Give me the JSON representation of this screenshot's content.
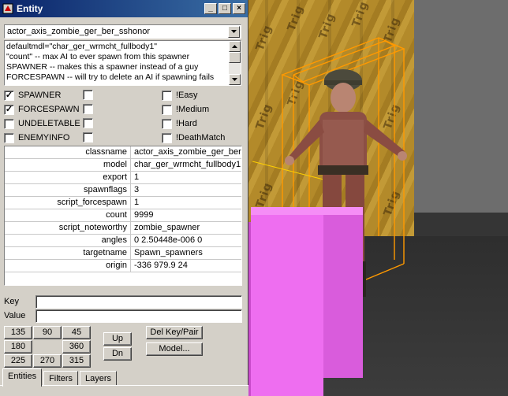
{
  "window": {
    "title": "Entity",
    "buttons": {
      "minimize": "_",
      "maximize": "□",
      "close": "×"
    }
  },
  "classname_combo": {
    "value": "actor_axis_zombie_ger_ber_sshonor"
  },
  "description": [
    "defaultmdl=\"char_ger_wrmcht_fullbody1\"",
    "\"count\" -- max AI to ever spawn from this spawner",
    "SPAWNER -- makes this a spawner instead of a guy",
    "FORCESPAWN -- will try to delete an AI if spawning fails"
  ],
  "flags": {
    "left": [
      {
        "label": "SPAWNER",
        "checked": true
      },
      {
        "label": "FORCESPAWN",
        "checked": true
      },
      {
        "label": "UNDELETABLE",
        "checked": false
      },
      {
        "label": "ENEMYINFO",
        "checked": false
      }
    ],
    "right": [
      {
        "label": "!Easy",
        "checked": false
      },
      {
        "label": "!Medium",
        "checked": false
      },
      {
        "label": "!Hard",
        "checked": false
      },
      {
        "label": "!DeathMatch",
        "checked": false
      }
    ]
  },
  "keyvalues": [
    {
      "key": "classname",
      "value": "actor_axis_zombie_ger_ber"
    },
    {
      "key": "model",
      "value": "char_ger_wrmcht_fullbody1"
    },
    {
      "key": "export",
      "value": "1"
    },
    {
      "key": "spawnflags",
      "value": "3"
    },
    {
      "key": "script_forcespawn",
      "value": "1"
    },
    {
      "key": "count",
      "value": "9999"
    },
    {
      "key": "script_noteworthy",
      "value": "zombie_spawner"
    },
    {
      "key": "angles",
      "value": "0 2.50448e-006 0"
    },
    {
      "key": "targetname",
      "value": "Spawn_spawners"
    },
    {
      "key": "origin",
      "value": "-336 979.9 24"
    }
  ],
  "key_field": {
    "label": "Key",
    "value": ""
  },
  "value_field": {
    "label": "Value",
    "value": ""
  },
  "angle_buttons": {
    "a135": "135",
    "a90": "90",
    "a45": "45",
    "a180": "180",
    "a360": "360",
    "a225": "225",
    "a270": "270",
    "a315": "315"
  },
  "up_label": "Up",
  "dn_label": "Dn",
  "del_keypair_label": "Del Key/Pair",
  "model_label": "Model...",
  "tabs": [
    "Entities",
    "Filters",
    "Layers"
  ],
  "viewport": {
    "wall_text": "Trig",
    "colors": {
      "trigger_wall": "#b38a2a",
      "pink_brush": "#ee6ef0",
      "selection_box": "#ff9900"
    }
  }
}
